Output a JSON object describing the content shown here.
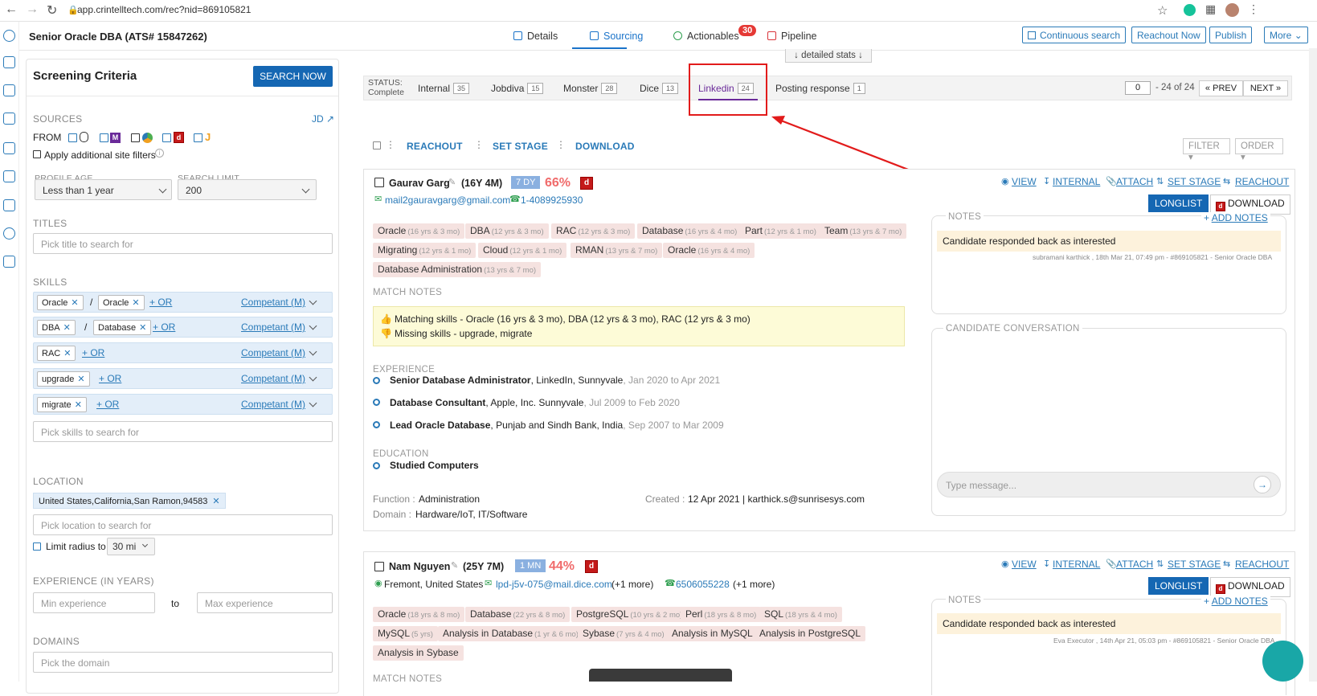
{
  "browser": {
    "url": "app.crintelltech.com/rec?nid=869105821"
  },
  "header": {
    "job_title": "Senior Oracle DBA (ATS# 15847262)",
    "tabs": [
      "Details",
      "Sourcing",
      "Actionables",
      "Pipeline"
    ],
    "actionables_badge": "30",
    "buttons": [
      "Continuous search",
      "Reachout Now",
      "Publish",
      "More"
    ],
    "detailed_stats": "detailed stats"
  },
  "sidebar": {
    "title": "Screening Criteria",
    "search_btn": "SEARCH NOW",
    "sources_label": "SOURCES",
    "jd_link": "JD",
    "from_label": "FROM",
    "additional_filters": "Apply additional site filters",
    "profile_age_label": "PROFILE AGE",
    "profile_age_value": "Less than 1 year",
    "search_limit_label": "SEARCH LIMIT",
    "search_limit_value": "200",
    "titles_label": "TITLES",
    "titles_placeholder": "Pick title to search for",
    "skills_label": "SKILLS",
    "skills": [
      {
        "chips": [
          "Oracle",
          "Oracle"
        ],
        "or": "+ OR",
        "level": "Competant (M)"
      },
      {
        "chips": [
          "DBA",
          "Database"
        ],
        "or": "+ OR",
        "level": "Competant (M)"
      },
      {
        "chips": [
          "RAC"
        ],
        "or": "+ OR",
        "level": "Competant (M)"
      },
      {
        "chips": [
          "upgrade"
        ],
        "or": "+ OR",
        "level": "Competant (M)"
      },
      {
        "chips": [
          "migrate"
        ],
        "or": "+ OR",
        "level": "Competant (M)"
      }
    ],
    "skills_placeholder": "Pick skills to search for",
    "location_label": "LOCATION",
    "location_chip": "United States,California,San Ramon,94583",
    "location_placeholder": "Pick location to search for",
    "limit_radius_label": "Limit radius to",
    "radius_value": "30 mi",
    "experience_label": "EXPERIENCE (IN YEARS)",
    "min_exp_placeholder": "Min experience",
    "to_label": "to",
    "max_exp_placeholder": "Max experience",
    "domains_label": "DOMAINS",
    "domain_placeholder": "Pick the domain"
  },
  "status": {
    "label": "STATUS:",
    "value": "Complete",
    "tabs": [
      {
        "name": "Internal",
        "count": "35"
      },
      {
        "name": "Jobdiva",
        "count": "15"
      },
      {
        "name": "Monster",
        "count": "28"
      },
      {
        "name": "Dice",
        "count": "13"
      },
      {
        "name": "Linkedin",
        "count": "24"
      },
      {
        "name": "Posting response",
        "count": "1"
      }
    ],
    "page_value": "0",
    "page_of": "- 24 of 24",
    "prev": "PREV",
    "next": "NEXT"
  },
  "actions": {
    "reachout": "REACHOUT",
    "set_stage": "SET STAGE",
    "download": "DOWNLOAD",
    "filter": "FILTER",
    "order": "ORDER"
  },
  "candidates": [
    {
      "name": "Gaurav Garg",
      "exp": "(16Y 4M)",
      "age_tag": "7 DY",
      "match": "66%",
      "email": "mail2gauravgarg@gmail.com",
      "phone": "1-4089925930",
      "links": [
        "VIEW",
        "INTERNAL",
        "ATTACH",
        "SET STAGE",
        "REACHOUT"
      ],
      "longlist": "LONGLIST",
      "download": "DOWNLOAD",
      "skills": [
        {
          "n": "Oracle",
          "y": "(16 yrs & 3 mo)"
        },
        {
          "n": "DBA",
          "y": "(12 yrs & 3 mo)"
        },
        {
          "n": "RAC",
          "y": "(12 yrs & 3 mo)"
        },
        {
          "n": "Database",
          "y": "(16 yrs & 4 mo)"
        },
        {
          "n": "Part",
          "y": "(12 yrs & 1 mo)"
        },
        {
          "n": "Team",
          "y": "(13 yrs & 7 mo)"
        },
        {
          "n": "Migrating",
          "y": "(12 yrs & 1 mo)"
        },
        {
          "n": "Cloud",
          "y": "(12 yrs & 1 mo)"
        },
        {
          "n": "RMAN",
          "y": "(13 yrs & 7 mo)"
        },
        {
          "n": "Oracle",
          "y": "(16 yrs & 4 mo)"
        },
        {
          "n": "Database Administration",
          "y": "(13 yrs & 7 mo)"
        }
      ],
      "match_notes_label": "MATCH NOTES",
      "matching": "Matching skills - Oracle (16 yrs & 3 mo), DBA (12 yrs & 3 mo), RAC (12 yrs & 3 mo)",
      "missing": "Missing skills - upgrade, migrate",
      "experience_label": "EXPERIENCE",
      "experience": [
        {
          "role": "Senior Database Administrator",
          "org": ", LinkedIn, Sunnyvale",
          "dates": ", Jan 2020 to Apr 2021"
        },
        {
          "role": "Database Consultant",
          "org": ", Apple, Inc. Sunnyvale",
          "dates": ", Jul 2009 to Feb 2020"
        },
        {
          "role": "Lead Oracle Database",
          "org": ", Punjab and Sindh Bank, India",
          "dates": ", Sep 2007 to Mar 2009"
        }
      ],
      "education_label": "EDUCATION",
      "education": "Studied Computers",
      "function_label": "Function :",
      "function": "Administration",
      "domain_label": "Domain :",
      "domain": "Hardware/IoT, IT/Software",
      "created_label": "Created :",
      "created": "12 Apr 2021 | karthick.s@sunrisesys.com",
      "notes_label": "NOTES",
      "add_notes": "ADD NOTES",
      "note_text": "Candidate responded back as interested",
      "note_meta": "subramani karthick , 18th Mar 21, 07:49 pm - #869105821 - Senior Oracle DBA",
      "conv_label": "CANDIDATE CONVERSATION",
      "msg_placeholder": "Type message..."
    },
    {
      "name": "Nam Nguyen",
      "exp": "(25Y 7M)",
      "age_tag": "1 MN",
      "match": "44%",
      "location": "Fremont, United States",
      "email": "lpd-j5v-075@mail.dice.com",
      "email_more": "(+1 more)",
      "phone": "6506055228",
      "phone_more": "(+1 more)",
      "links": [
        "VIEW",
        "INTERNAL",
        "ATTACH",
        "SET STAGE",
        "REACHOUT"
      ],
      "longlist": "LONGLIST",
      "download": "DOWNLOAD",
      "skills": [
        {
          "n": "Oracle",
          "y": "(18 yrs & 8 mo)"
        },
        {
          "n": "Database",
          "y": "(22 yrs & 8 mo)"
        },
        {
          "n": "PostgreSQL",
          "y": "(10 yrs & 2 mo)"
        },
        {
          "n": "Perl",
          "y": "(18 yrs & 8 mo)"
        },
        {
          "n": "SQL",
          "y": "(18 yrs & 4 mo)"
        },
        {
          "n": "MySQL",
          "y": "(5 yrs)"
        },
        {
          "n": "Analysis in Database",
          "y": "(1 yr & 6 mo)"
        },
        {
          "n": "Sybase",
          "y": "(7 yrs & 4 mo)"
        },
        {
          "n": "Analysis in MySQL",
          "y": ""
        },
        {
          "n": "Analysis in PostgreSQL",
          "y": ""
        },
        {
          "n": "Analysis in Sybase",
          "y": ""
        }
      ],
      "match_notes_label": "MATCH NOTES",
      "notes_label": "NOTES",
      "add_notes": "ADD NOTES",
      "note_text": "Candidate responded back as interested",
      "note_meta": "Eva Executor , 14th Apr 21, 05:03 pm - #869105821 - Senior Oracle DBA"
    }
  ]
}
